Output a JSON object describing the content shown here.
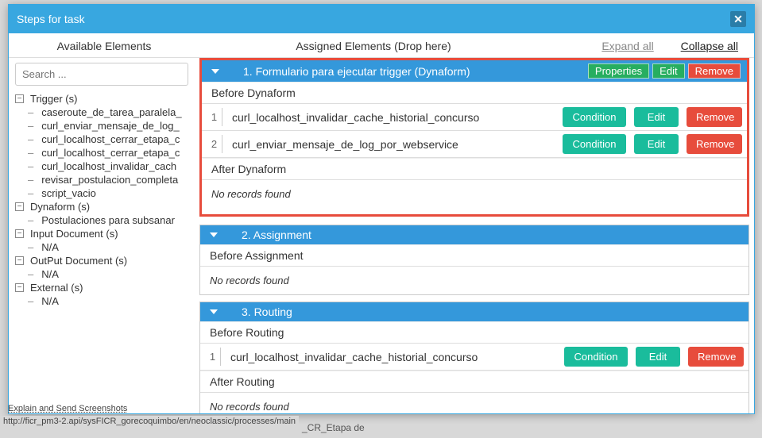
{
  "dialog": {
    "title": "Steps for task",
    "tabs": {
      "available": "Available Elements",
      "assigned": "Assigned Elements (Drop here)",
      "expand": "Expand all",
      "collapse": "Collapse all"
    }
  },
  "search": {
    "placeholder": "Search ..."
  },
  "tree": {
    "trigger": {
      "label": "Trigger (s)",
      "items": [
        "caseroute_de_tarea_paralela_",
        "curl_enviar_mensaje_de_log_",
        "curl_localhost_cerrar_etapa_c",
        "curl_localhost_cerrar_etapa_c",
        "curl_localhost_invalidar_cach",
        "revisar_postulacion_completa",
        "script_vacio"
      ]
    },
    "dynaform": {
      "label": "Dynaform (s)",
      "items": [
        "Postulaciones para subsanar"
      ]
    },
    "inputdoc": {
      "label": "Input Document (s)",
      "items": [
        "N/A"
      ]
    },
    "outputdoc": {
      "label": "OutPut Document (s)",
      "items": [
        "N/A"
      ]
    },
    "external": {
      "label": "External (s)",
      "items": [
        "N/A"
      ]
    }
  },
  "sections": {
    "formulario": {
      "title": "1. Formulario para ejecutar trigger (Dynaform)",
      "btn_props": "Properties",
      "btn_edit": "Edit",
      "btn_remove": "Remove",
      "before_label": "Before Dynaform",
      "after_label": "After Dynaform",
      "rows": [
        {
          "idx": "1",
          "name": "curl_localhost_invalidar_cache_historial_concurso"
        },
        {
          "idx": "2",
          "name": "curl_enviar_mensaje_de_log_por_webservice"
        }
      ]
    },
    "assignment": {
      "title": "2. Assignment",
      "before_label": "Before Assignment"
    },
    "routing": {
      "title": "3. Routing",
      "before_label": "Before Routing",
      "after_label": "After Routing",
      "rows": [
        {
          "idx": "1",
          "name": "curl_localhost_invalidar_cache_historial_concurso"
        }
      ]
    }
  },
  "labels": {
    "no_records": "No records found",
    "condition": "Condition",
    "edit": "Edit",
    "remove": "Remove"
  },
  "footer": {
    "explain": "Explain and Send Screenshots",
    "url": "http://ficr_pm3-2.api/sysFICR_gorecoquimbo/en/neoclassic/processes/main"
  },
  "bg": "_CR_Etapa de"
}
